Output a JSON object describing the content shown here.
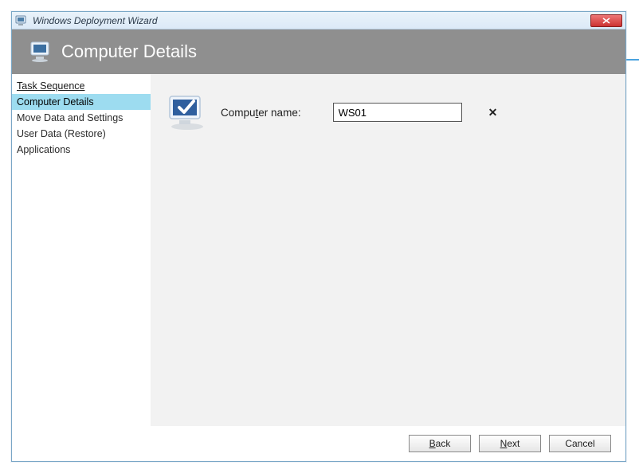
{
  "titlebar": {
    "title": "Windows Deployment Wizard"
  },
  "banner": {
    "title": "Computer Details"
  },
  "sidebar": {
    "items": [
      {
        "label": "Task Sequence"
      },
      {
        "label": "Computer Details"
      },
      {
        "label": "Move Data and Settings"
      },
      {
        "label": "User Data (Restore)"
      },
      {
        "label": "Applications"
      }
    ]
  },
  "form": {
    "computer_name_label_pre": "Compu",
    "computer_name_label_accel": "t",
    "computer_name_label_post": "er name:",
    "computer_name_value": "WS01"
  },
  "footer": {
    "back_accel": "B",
    "back_rest": "ack",
    "next_accel": "N",
    "next_rest": "ext",
    "cancel": "Cancel"
  }
}
